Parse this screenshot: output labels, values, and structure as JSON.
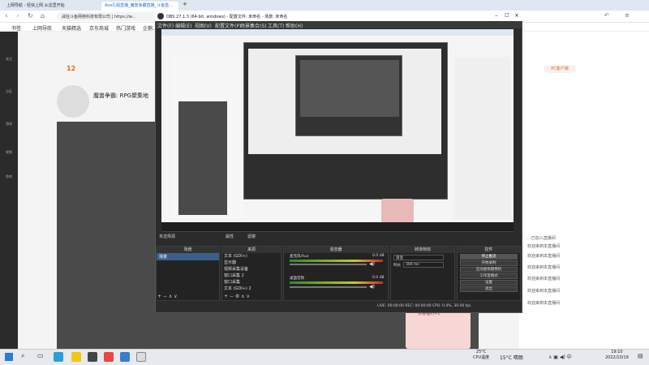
{
  "browser": {
    "tabs": [
      {
        "label": "上网导航 - 轻快上网 从这里开始",
        "active": false
      },
      {
        "label": "Ace孔姐直播_魔兽争霸直播_斗鱼直...",
        "active": true
      },
      {
        "label": "+",
        "active": false
      }
    ],
    "url_text": "战狂斗鱼网络科技有限公司 | https://w...",
    "bookmarks": [
      "书签",
      "上网导航",
      "天猫精选",
      "京东商城",
      "热门游戏",
      "企鹅..."
    ]
  },
  "page": {
    "rail": [
      "关注",
      "分区",
      "游戏",
      "视频",
      "鱼吧"
    ],
    "streamer_name": "魔兽争霸: RPG聚集地",
    "level_badge": "12",
    "promo_text": "PC客户端",
    "chat_lines": [
      "...已加入直播间",
      "欢迎来到本直播间",
      "欢迎来到本直播间",
      "欢迎来到本直播间",
      "欢迎来到本直播间",
      "欢迎来到本直播间",
      "欢迎来到本直播间"
    ],
    "promo_box": "恭喜福利+1"
  },
  "obs": {
    "title": "OBS 27.1.3 (64-bit, windows) - 配置文件: 未命名 - 场景: 未命名",
    "menu": [
      "文件(F)",
      "编辑(E)",
      "视图(V)",
      "配置文件(P)",
      "场景集合(S)",
      "工具(T)",
      "帮助(H)"
    ],
    "status_line": "未选择源",
    "props_buttons": [
      "属性",
      "滤镜"
    ],
    "panels": {
      "scenes": {
        "header": "场景",
        "items": [
          "场景"
        ]
      },
      "sources": {
        "header": "来源",
        "items": [
          "文本 (GDI+)",
          "显示器",
          "视频采集设备",
          "窗口采集 2",
          "窗口采集",
          "文本 (GDI+) 2",
          "显示器"
        ]
      },
      "mixer": {
        "header": "混音器",
        "tracks": [
          {
            "name": "桌面音频",
            "db": "0.0 dB"
          },
          {
            "name": "麦克风/Aux",
            "db": "0.0 dB"
          }
        ]
      },
      "transitions": {
        "header": "转场特效",
        "type": "渐变",
        "duration_label": "时长",
        "duration": "300 ms"
      },
      "controls": {
        "header": "控件",
        "buttons": [
          "停止推流",
          "开始录制",
          "启动虚拟摄像机",
          "工作室模式",
          "设置",
          "退出"
        ]
      }
    },
    "statusbar": "LIVE: 00:00:00    REC: 00:00:00    CPU: 0.4%, 30.00 fps"
  },
  "taskbar": {
    "weather_temp": "25°C",
    "weather_desc": "CPU温度",
    "weather_right": "15°C 晴朗",
    "time": "19:10",
    "date": "2022/10/19"
  }
}
